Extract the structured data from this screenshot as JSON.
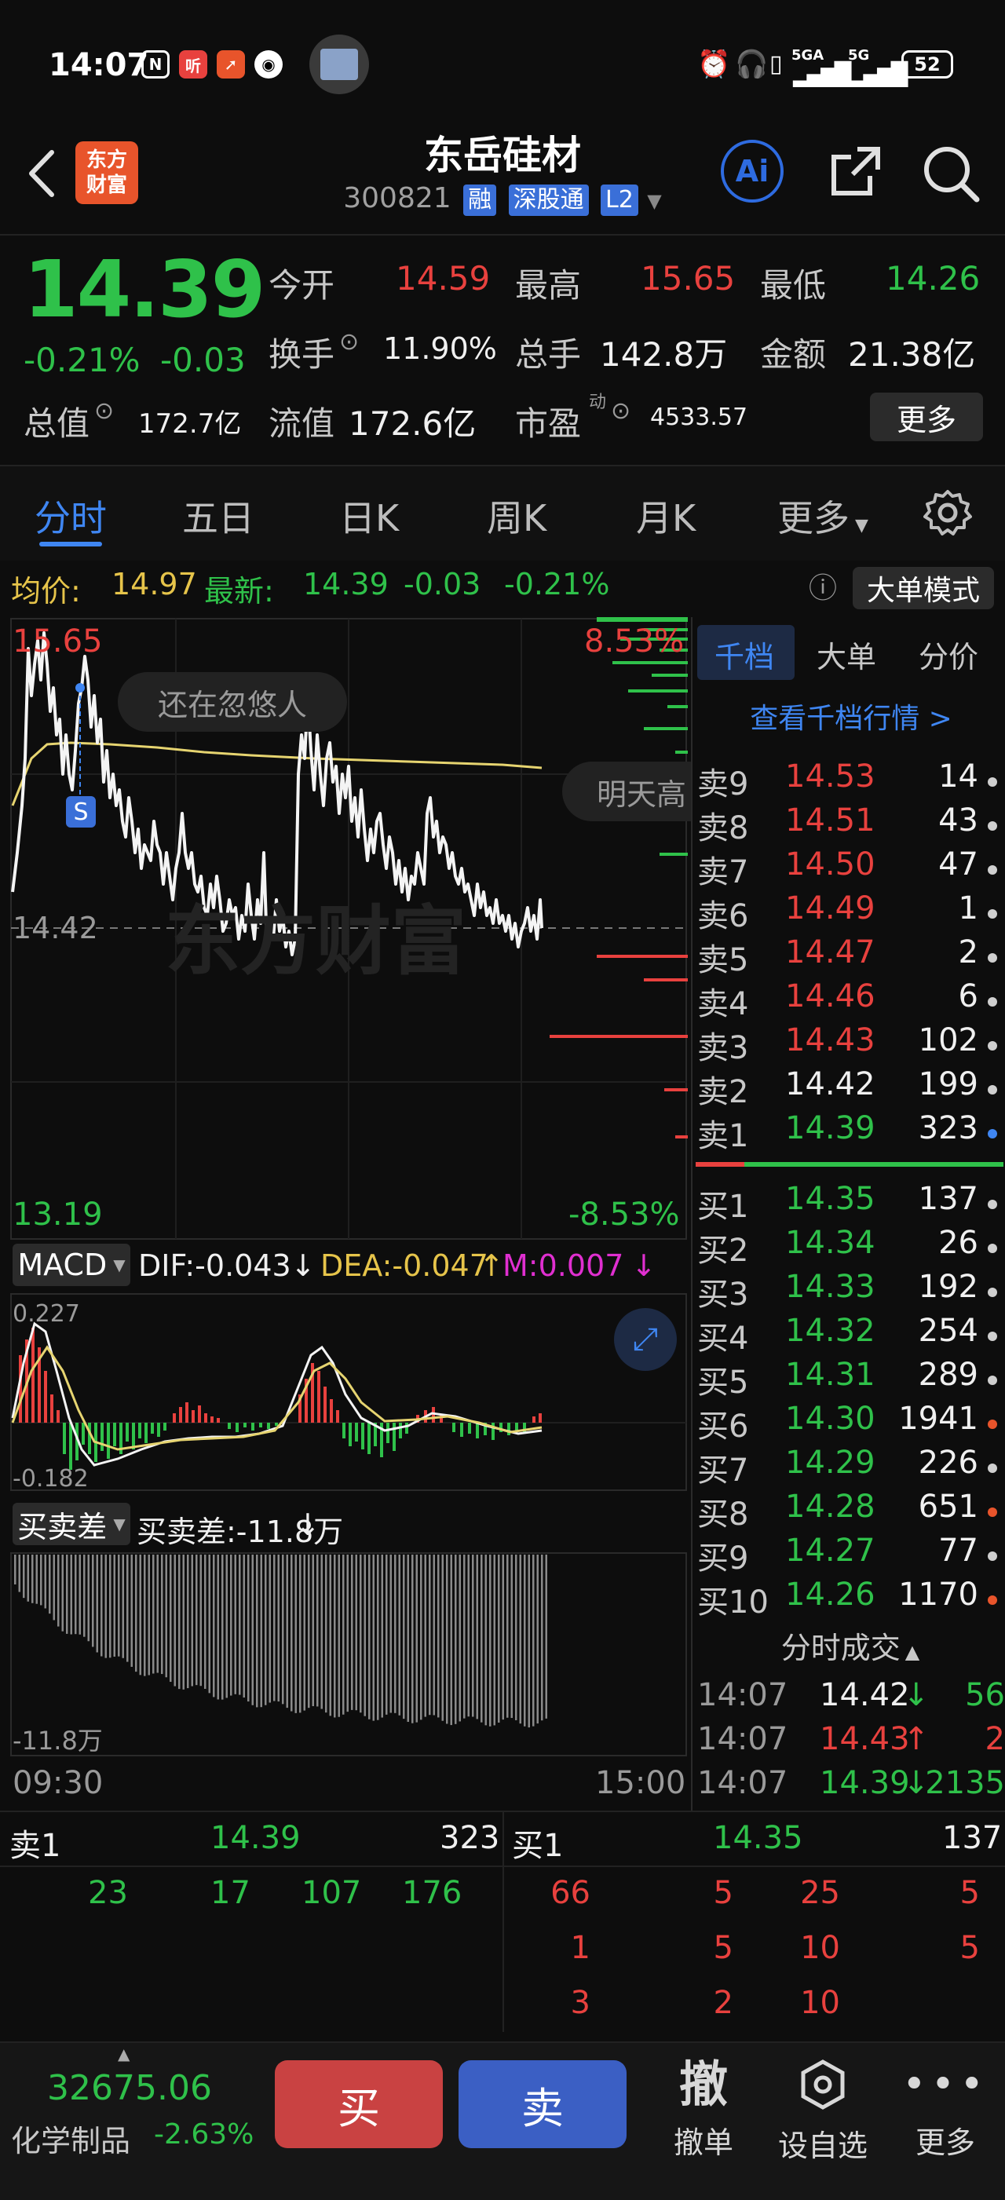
{
  "status": {
    "time": "14:07",
    "battery": "52",
    "net1": "5GA",
    "net2": "5G"
  },
  "header": {
    "logo_line1": "东方",
    "logo_line2": "财富",
    "title": "东岳硅材",
    "code": "300821",
    "tags": [
      "融",
      "深股通",
      "L2"
    ],
    "ai_label": "Ai"
  },
  "quote": {
    "price": "14.39",
    "change_pct": "-0.21%",
    "change": "-0.03",
    "open_label": "今开",
    "open": "14.59",
    "high_label": "最高",
    "high": "15.65",
    "low_label": "最低",
    "low": "14.26",
    "turnover_label": "换手",
    "turnover": "11.90%",
    "volume_label": "总手",
    "volume": "142.8万",
    "amount_label": "金额",
    "amount": "21.38亿",
    "mktcap_label": "总值",
    "mktcap": "172.7亿",
    "float_label": "流值",
    "float": "172.6亿",
    "pe_label": "市盈",
    "pe_sup": "动",
    "pe": "4533.57",
    "more_label": "更多"
  },
  "tabs": [
    "分时",
    "五日",
    "日K",
    "周K",
    "月K",
    "更多"
  ],
  "info": {
    "avg_label": "均价:",
    "avg": "14.97",
    "latest_label": "最新:",
    "latest": "14.39",
    "latest_chg": "-0.03",
    "latest_pct": "-0.21%",
    "mode_label": "大单模式"
  },
  "chart": {
    "top_price": "15.65",
    "top_pct": "8.53%",
    "mid_price": "14.42",
    "bottom_price": "13.19",
    "bottom_pct": "-8.53%",
    "bubble1": "还在忽悠人",
    "bubble2": "明天高",
    "s_marker": "S",
    "watermark": "东方财富"
  },
  "macd": {
    "label": "MACD",
    "dif": "DIF:-0.043",
    "dif_arrow": "↓",
    "dea": "DEA:-0.047",
    "dea_arrow": "↑",
    "m": "M:0.007",
    "m_arrow": "↓",
    "top": "0.227",
    "bottom": "-0.182"
  },
  "spread": {
    "label": "买卖差",
    "value": "买卖差:-11.8万",
    "arrow": "↓",
    "bottom": "-11.8万",
    "time_start": "09:30",
    "time_end": "15:00"
  },
  "right_panel": {
    "tabs": [
      "千档",
      "大单",
      "分价"
    ],
    "link": "查看千档行情 >",
    "asks": [
      {
        "label": "卖9",
        "price": "14.53",
        "vol": "14"
      },
      {
        "label": "卖8",
        "price": "14.51",
        "vol": "43"
      },
      {
        "label": "卖7",
        "price": "14.50",
        "vol": "47"
      },
      {
        "label": "卖6",
        "price": "14.49",
        "vol": "1"
      },
      {
        "label": "卖5",
        "price": "14.47",
        "vol": "2"
      },
      {
        "label": "卖4",
        "price": "14.46",
        "vol": "6"
      },
      {
        "label": "卖3",
        "price": "14.43",
        "vol": "102"
      },
      {
        "label": "卖2",
        "price": "14.42",
        "vol": "199"
      },
      {
        "label": "卖1",
        "price": "14.39",
        "vol": "323"
      }
    ],
    "bids": [
      {
        "label": "买1",
        "price": "14.35",
        "vol": "137"
      },
      {
        "label": "买2",
        "price": "14.34",
        "vol": "26"
      },
      {
        "label": "买3",
        "price": "14.33",
        "vol": "192"
      },
      {
        "label": "买4",
        "price": "14.32",
        "vol": "254"
      },
      {
        "label": "买5",
        "price": "14.31",
        "vol": "289"
      },
      {
        "label": "买6",
        "price": "14.30",
        "vol": "1941"
      },
      {
        "label": "买7",
        "price": "14.29",
        "vol": "226"
      },
      {
        "label": "买8",
        "price": "14.28",
        "vol": "651"
      },
      {
        "label": "买9",
        "price": "14.27",
        "vol": "77"
      },
      {
        "label": "买10",
        "price": "14.26",
        "vol": "1170"
      }
    ],
    "trades_title": "分时成交",
    "trades": [
      {
        "time": "14:07",
        "price": "14.42",
        "arrow": "↓",
        "vol": "56"
      },
      {
        "time": "14:07",
        "price": "14.43",
        "arrow": "↑",
        "vol": "2"
      },
      {
        "time": "14:07",
        "price": "14.39",
        "arrow": "↓",
        "vol": "2135"
      }
    ]
  },
  "orders": {
    "sell_label": "卖1",
    "sell_price": "14.39",
    "sell_vol": "323",
    "buy_label": "买1",
    "buy_price": "14.35",
    "buy_vol": "137",
    "sell_rows": [
      [
        "23",
        "17",
        "107",
        "176"
      ]
    ],
    "buy_rows": [
      [
        "66",
        "5",
        "25",
        "5"
      ],
      [
        "1",
        "5",
        "10",
        "5"
      ],
      [
        "3",
        "2",
        "10"
      ]
    ]
  },
  "bottom": {
    "index_value": "32675.06",
    "index_name": "化学制品",
    "index_pct": "-2.63%",
    "buy": "买",
    "sell": "卖",
    "cancel_icon_label": "撤",
    "cancel": "撤单",
    "watch": "设自选",
    "more": "更多"
  },
  "colors": {
    "up": "#e8413e",
    "down": "#2fc14a",
    "accent": "#3f86f2"
  }
}
